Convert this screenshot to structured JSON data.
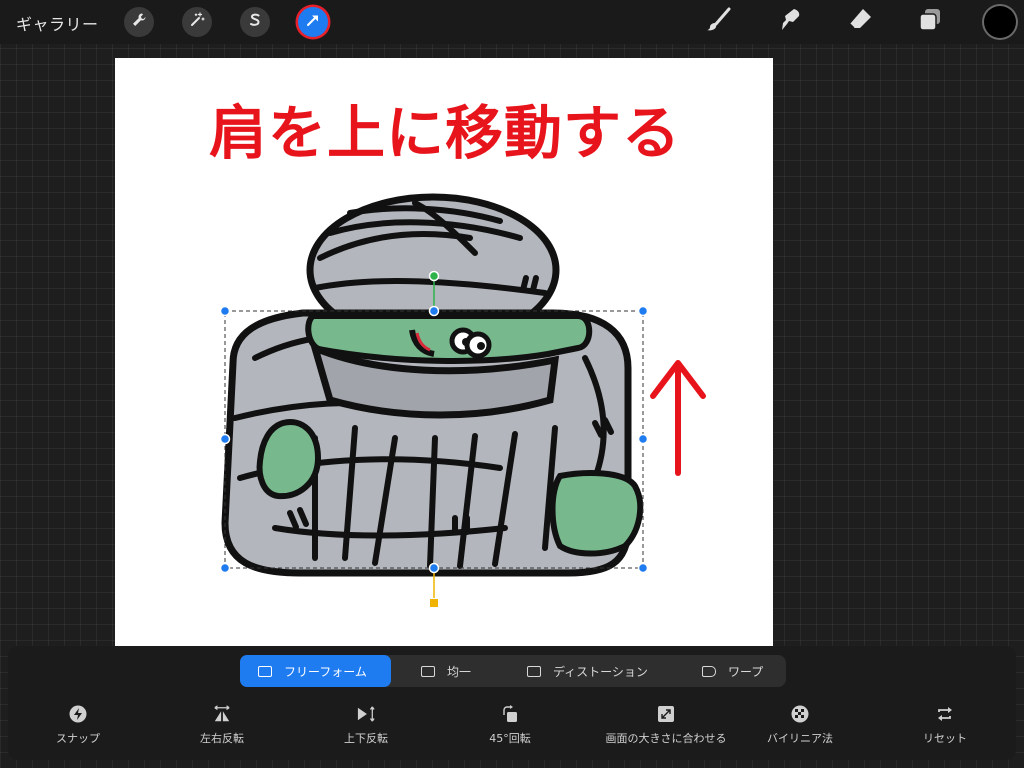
{
  "topbar": {
    "gallery_label": "ギャラリー",
    "left_tools": [
      {
        "icon": "wrench-icon"
      },
      {
        "icon": "magic-wand-icon"
      },
      {
        "icon": "selection-s-icon"
      },
      {
        "icon": "transform-arrow-icon",
        "active": true
      }
    ],
    "right_tools": [
      {
        "icon": "brush-icon"
      },
      {
        "icon": "smudge-icon"
      },
      {
        "icon": "eraser-icon"
      },
      {
        "icon": "layers-icon"
      }
    ],
    "current_color": "#000000"
  },
  "canvas": {
    "headline": "肩を上に移動する",
    "headline_color": "#e8141c",
    "arrow_color": "#e8141c"
  },
  "transform_modes": [
    {
      "label": "フリーフォーム",
      "active": true
    },
    {
      "label": "均一",
      "active": false
    },
    {
      "label": "ディストーション",
      "active": false
    },
    {
      "label": "ワープ",
      "active": false
    }
  ],
  "actions": [
    {
      "label": "スナップ",
      "icon": "snap-lightning-icon"
    },
    {
      "label": "左右反転",
      "icon": "flip-horizontal-icon"
    },
    {
      "label": "上下反転",
      "icon": "flip-vertical-icon"
    },
    {
      "label": "45°回転",
      "icon": "rotate-45-icon"
    },
    {
      "label": "画面の大きさに合わせる",
      "icon": "fit-screen-icon"
    },
    {
      "label": "バイリニア法",
      "icon": "bilinear-checker-icon"
    },
    {
      "label": "リセット",
      "icon": "reset-icon"
    }
  ],
  "accent_color": "#1e7bf0"
}
